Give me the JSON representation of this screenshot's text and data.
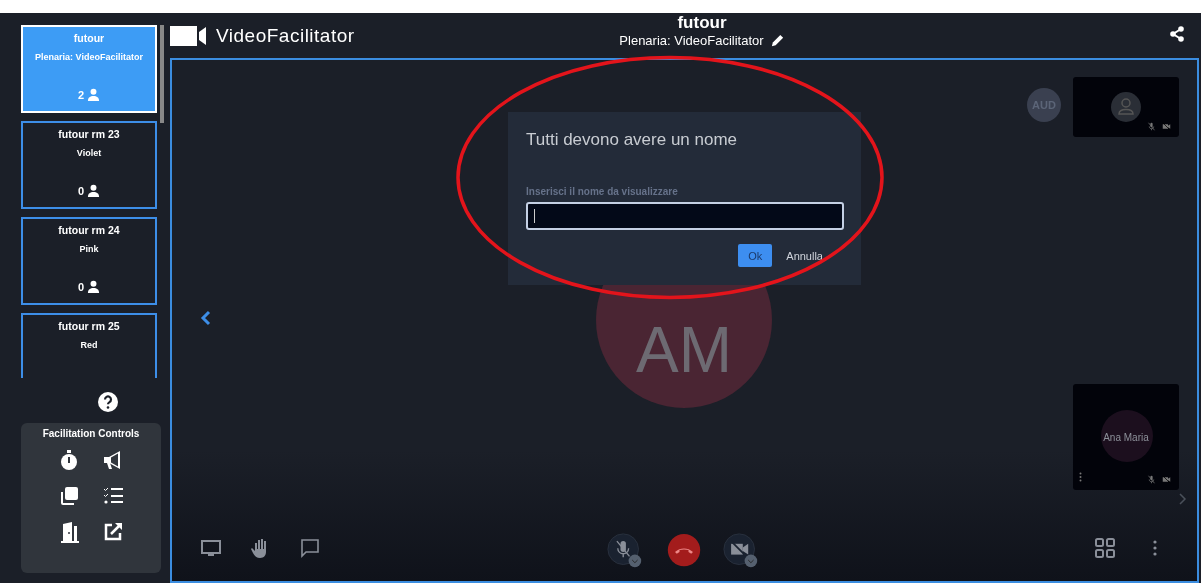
{
  "rooms": [
    {
      "name": "futour",
      "subtitle": "Plenaria: VideoFacilitator",
      "count": "2",
      "selected": true
    },
    {
      "name": "futour rm 23",
      "subtitle": "Violet",
      "count": "0",
      "selected": false
    },
    {
      "name": "futour rm 24",
      "subtitle": "Pink",
      "count": "0",
      "selected": false
    },
    {
      "name": "futour rm 25",
      "subtitle": "Red",
      "selected": false
    }
  ],
  "facilitation_controls": {
    "title": "Facilitation Controls"
  },
  "app": {
    "name": "VideoFacilitator"
  },
  "header": {
    "title": "futour",
    "subtitle": "Plenaria: VideoFacilitator"
  },
  "stage": {
    "avatar_initials": "AM",
    "self_badge": "AUD",
    "remote_name": "Ana Maria"
  },
  "dialog": {
    "title": "Tutti devono avere un nome",
    "field_label": "Inserisci il nome da visualizzare",
    "buttons": [
      "Ok",
      "Annulla"
    ]
  }
}
